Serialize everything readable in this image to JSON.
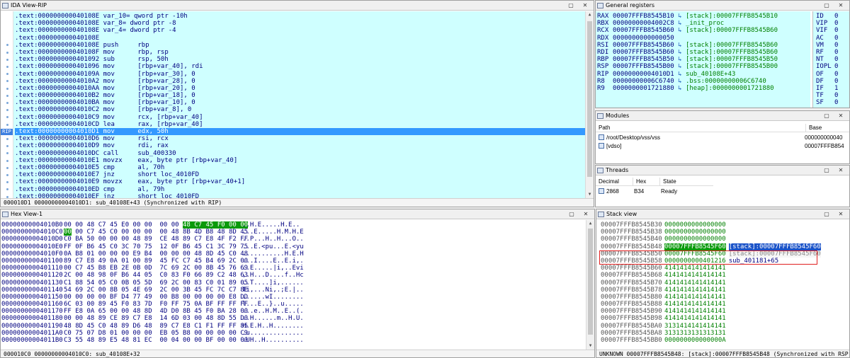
{
  "ida_view": {
    "title": "IDA View-RIP",
    "rip_label": "RIP",
    "lines": [
      ".text:000000000040108E var_10= qword ptr -10h",
      ".text:000000000040108E var_8= dword ptr -8",
      ".text:000000000040108E var_4= dword ptr -4",
      ".text:000000000040108E",
      ".text:000000000040108E push     rbp",
      ".text:000000000040108F mov      rbp, rsp",
      ".text:0000000000401092 sub      rsp, 50h",
      ".text:0000000000401096 mov      [rbp+var_40], rdi",
      ".text:000000000040109A mov      [rbp+var_30], 0",
      ".text:00000000004010A2 mov      [rbp+var_28], 0",
      ".text:00000000004010AA mov      [rbp+var_20], 0",
      ".text:00000000004010B2 mov      [rbp+var_18], 0",
      ".text:00000000004010BA mov      [rbp+var_10], 0",
      ".text:00000000004010C2 mov      [rbp+var_8], 0",
      ".text:00000000004010C9 mov      rcx, [rbp+var_40]",
      ".text:00000000004010CD lea      rax, [rbp+var_40]",
      ".text:00000000004010D1 mov      edx, 50h",
      ".text:00000000004010D6 mov      rsi, rcx",
      ".text:00000000004010D9 mov      rdi, rax",
      ".text:00000000004010DC call     sub_400330",
      ".text:00000000004010E1 movzx    eax, byte ptr [rbp+var_40]",
      ".text:00000000004010E5 cmp      al, 70h",
      ".text:00000000004010E7 jnz      short loc_4010FD",
      ".text:00000000004010E9 movzx    eax, byte ptr [rbp+var_40+1]",
      ".text:00000000004010ED cmp      al, 79h",
      ".text:00000000004010EF jnz      short loc_4010FD"
    ],
    "selected_index": 16,
    "status": "000010D1 00000000004010D1: sub_40108E+43 (Synchronized with RIP)"
  },
  "registers": {
    "title": "General registers",
    "rows": [
      {
        "name": "RAX",
        "value": "00007FFFB8545B10",
        "note": "[stack]:00007FFFB8545B10"
      },
      {
        "name": "RBX",
        "value": "00000000004002C8",
        "note": "_init_proc"
      },
      {
        "name": "RCX",
        "value": "00007FFFB8545B60",
        "note": "[stack]:00007FFFB8545B60"
      },
      {
        "name": "RDX",
        "value": "0000000000000050",
        "note": ""
      },
      {
        "name": "RSI",
        "value": "00007FFFB8545B60",
        "note": "[stack]:00007FFFB8545B60"
      },
      {
        "name": "RDI",
        "value": "00007FFFB8545B60",
        "note": "[stack]:00007FFFB8545B60"
      },
      {
        "name": "RBP",
        "value": "00007FFFB8545B50",
        "note": "[stack]:00007FFFB8545B50"
      },
      {
        "name": "RSP",
        "value": "00007FFFB8545B00",
        "note": "[stack]:00007FFFB8545B00"
      },
      {
        "name": "RIP",
        "value": "00000000004010D1",
        "note": "sub_40108E+43"
      },
      {
        "name": "R8",
        "value": "00000000006C6740",
        "note": ".bss:00000000006C6740"
      },
      {
        "name": "R9",
        "value": "0000000001721880",
        "note": "[heap]:0000000001721880"
      }
    ],
    "flags": [
      {
        "name": "ID",
        "value": "0"
      },
      {
        "name": "VIP",
        "value": "0"
      },
      {
        "name": "VIF",
        "value": "0"
      },
      {
        "name": "AC",
        "value": "0"
      },
      {
        "name": "VM",
        "value": "0"
      },
      {
        "name": "RF",
        "value": "0"
      },
      {
        "name": "NT",
        "value": "0"
      },
      {
        "name": "IOPL",
        "value": "0"
      },
      {
        "name": "OF",
        "value": "0"
      },
      {
        "name": "DF",
        "value": "0"
      },
      {
        "name": "IF",
        "value": "1"
      },
      {
        "name": "TF",
        "value": "0"
      },
      {
        "name": "SF",
        "value": "0"
      }
    ]
  },
  "modules": {
    "title": "Modules",
    "col_path": "Path",
    "col_base": "Base",
    "rows": [
      {
        "path": "/root/Desktop/vss/vss",
        "base": "000000000040"
      },
      {
        "path": "[vdso]",
        "base": "00007FFFB854"
      }
    ]
  },
  "threads": {
    "title": "Threads",
    "col_decimal": "Decimal",
    "col_hex": "Hex",
    "col_state": "State",
    "rows": [
      {
        "decimal": "2868",
        "hex": "B34",
        "state": "Ready"
      }
    ]
  },
  "hex_view": {
    "title": "Hex View-1",
    "rows": [
      {
        "addr": "00000000004010B0",
        "pre": "00 00 48 C7 45 E0 00 00  00 00 ",
        "hl": "48 C7 45 F0 00 00",
        "post": "",
        "ascii": "..H.E.....H.E.."
      },
      {
        "addr": "00000000004010C0",
        "pre": "",
        "hl": "00",
        "post": " 00 C7 45 C0 00 00 00  00 48 8B 4D B8 48 8D 45",
        "ascii": "...E.....H.M.H.E"
      },
      {
        "addr": "00000000004010D0",
        "pre": "C0 BA 50 00 00 00 48 89  CE 48 89 C7 E8 4F F2 FF",
        "hl": "",
        "post": "",
        "ascii": "..P...H..H...O.."
      },
      {
        "addr": "00000000004010E0",
        "pre": "FF 0F B6 45 C0 3C 70 75  12 0F B6 45 C1 3C 79 75",
        "hl": "",
        "post": "",
        "ascii": "...E.<pu...E.<yu"
      },
      {
        "addr": "00000000004010F0",
        "pre": "0A B8 01 00 00 00 E9 B4  00 00 00 48 8D 45 C0 48",
        "hl": "",
        "post": "",
        "ascii": "...........H.E.H"
      },
      {
        "addr": "0000000000401100",
        "pre": "89 C7 E8 49 0A 01 00 89  45 FC C7 45 B4 69 2C 00",
        "hl": "",
        "post": "",
        "ascii": "...I....E..E.i,."
      },
      {
        "addr": "0000000000401110",
        "pre": "00 C7 45 B8 EB 2E 0B 0D  7C 69 2C 00 8B 45 76 69",
        "hl": "",
        "post": "",
        "ascii": "..E.....|i,..Evi"
      },
      {
        "addr": "0000000000401120",
        "pre": "2C 00 48 98 0F B6 44 05  C0 83 F0 66 89 C2 48 63",
        "hl": "",
        "post": "",
        "ascii": ",.H...D....f..Hc"
      },
      {
        "addr": "0000000000401130",
        "pre": "C1 88 54 05 C0 0B 05 5D  69 2C 00 83 C0 01 89 05",
        "hl": "",
        "post": "",
        "ascii": "..T....]i,......"
      },
      {
        "addr": "0000000000401140",
        "pre": "54 69 2C 00 8B 05 4E 69  2C 00 3B 45 FC 7C C7 8E",
        "hl": "",
        "post": "",
        "ascii": "Ti,...Ni,.;E.|.."
      },
      {
        "addr": "0000000000401150",
        "pre": "00 00 00 00 BF D4 77 49  00 B8 00 00 00 00 E8 DD",
        "hl": "",
        "post": "",
        "ascii": "......wI........"
      },
      {
        "addr": "0000000000401160",
        "pre": "6C 03 00 89 45 F0 83 7D  F0 FF 75 0A BF FF FF FF",
        "hl": "",
        "post": "",
        "ascii": "l...E..}..u....."
      },
      {
        "addr": "0000000000401170",
        "pre": "FF E8 0A 65 00 00 48 8D  4D D0 8B 45 F0 BA 28 00",
        "hl": "",
        "post": "",
        "ascii": "...e..H.M..E..(."
      },
      {
        "addr": "0000000000401180",
        "pre": "00 00 48 89 CE 89 C7 E8  14 6D 03 00 48 8D 55 D0",
        "hl": "",
        "post": "",
        "ascii": "..H......m..H.U."
      },
      {
        "addr": "0000000000401190",
        "pre": "48 8D 45 C0 48 89 D6 48  89 C7 E8 C1 F1 FF FF 85",
        "hl": "",
        "post": "",
        "ascii": "H.E.H..H........"
      },
      {
        "addr": "00000000004011A0",
        "pre": "C0 75 07 D8 01 00 00 00  EB 05 B8 00 00 00 00 C9",
        "hl": "",
        "post": "",
        "ascii": ".u.............."
      },
      {
        "addr": "00000000004011B0",
        "pre": "C3 55 48 89 E5 48 81 EC  00 04 00 00 BF 00 00 00",
        "hl": "",
        "post": "",
        "ascii": ".UH..H.........."
      }
    ],
    "status": "000010C0 00000000004010C0: sub_40108E+32"
  },
  "stack_view": {
    "title": "Stack view",
    "rows": [
      {
        "addr": "00007FFFB8545B30",
        "val": "0000000000000000",
        "note": ""
      },
      {
        "addr": "00007FFFB8545B38",
        "val": "0000000000000000",
        "note": ""
      },
      {
        "addr": "00007FFFB8545B40",
        "val": "0000000000000000",
        "note": ""
      },
      {
        "addr": "00007FFFB8545B48",
        "val": "00007FFFB8545F60",
        "note": "[stack]:00007FFFB8545F60"
      },
      {
        "addr": "00007FFFB8545B50",
        "val": "00007FFFB8545F60",
        "note": "[stack]:00007FFFB8545F60"
      },
      {
        "addr": "00007FFFB8545B58",
        "val": "0000000000401216",
        "note": "sub_401181+65"
      },
      {
        "addr": "00007FFFB8545B60",
        "val": "4141414141414141",
        "note": ""
      },
      {
        "addr": "00007FFFB8545B68",
        "val": "4141414141414141",
        "note": ""
      },
      {
        "addr": "00007FFFB8545B70",
        "val": "4141414141414141",
        "note": ""
      },
      {
        "addr": "00007FFFB8545B78",
        "val": "4141414141414141",
        "note": ""
      },
      {
        "addr": "00007FFFB8545B80",
        "val": "4141414141414141",
        "note": ""
      },
      {
        "addr": "00007FFFB8545B88",
        "val": "4141414141414141",
        "note": ""
      },
      {
        "addr": "00007FFFB8545B90",
        "val": "4141414141414141",
        "note": ""
      },
      {
        "addr": "00007FFFB8545B98",
        "val": "4141414141414141",
        "note": ""
      },
      {
        "addr": "00007FFFB8545BA0",
        "val": "3131414141414141",
        "note": ""
      },
      {
        "addr": "00007FFFB8545BA8",
        "val": "3131313131313131",
        "note": ""
      },
      {
        "addr": "00007FFFB8545BB0",
        "val": "000000000000000A",
        "note": ""
      }
    ],
    "status": "UNKNOWN 00007FFFB8545B48: [stack]:00007FFFB8545B48 (Synchronized with RSP)"
  }
}
